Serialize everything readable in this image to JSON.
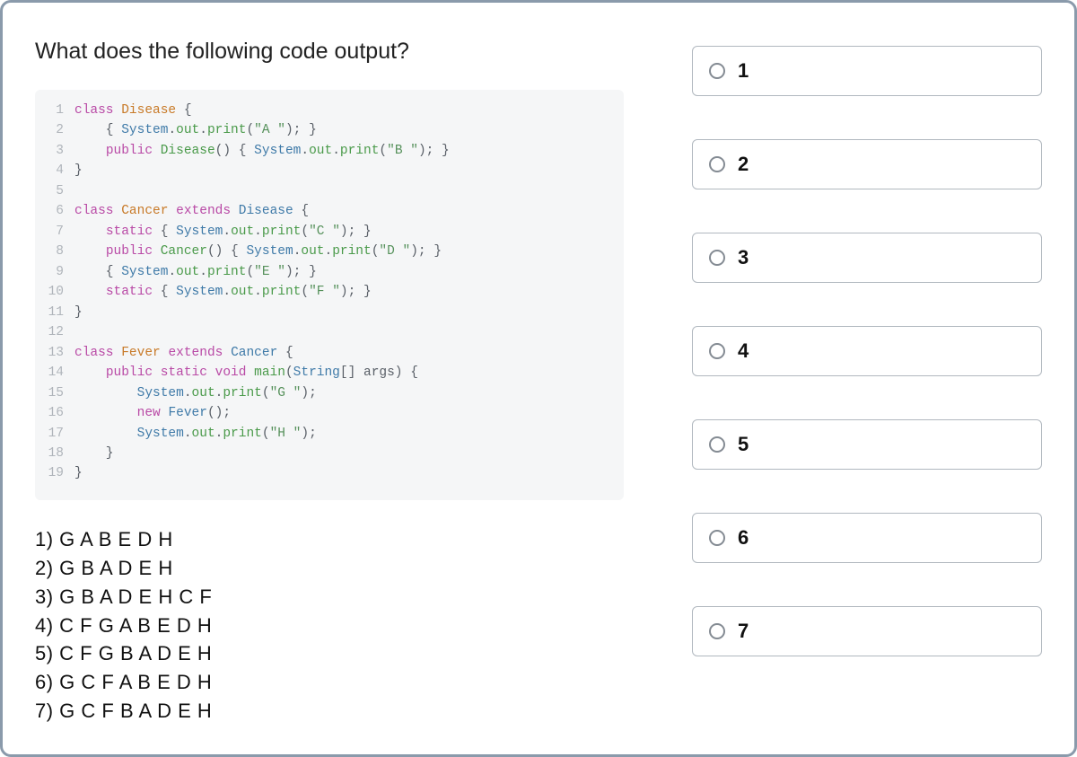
{
  "question": "What does the following code output?",
  "code": [
    {
      "n": "1",
      "tokens": [
        {
          "t": "class ",
          "c": "kw-struct"
        },
        {
          "t": "Disease",
          "c": "cls-def"
        },
        {
          "t": " {",
          "c": "punct"
        }
      ]
    },
    {
      "n": "2",
      "tokens": [
        {
          "t": "    { ",
          "c": "punct"
        },
        {
          "t": "System",
          "c": "obj"
        },
        {
          "t": ".",
          "c": "punct"
        },
        {
          "t": "out",
          "c": "method"
        },
        {
          "t": ".",
          "c": "punct"
        },
        {
          "t": "print",
          "c": "method"
        },
        {
          "t": "(",
          "c": "punct"
        },
        {
          "t": "\"A \"",
          "c": "str"
        },
        {
          "t": "); }",
          "c": "punct"
        }
      ]
    },
    {
      "n": "3",
      "tokens": [
        {
          "t": "    ",
          "c": ""
        },
        {
          "t": "public ",
          "c": "kw-struct"
        },
        {
          "t": "Disease",
          "c": "method"
        },
        {
          "t": "() { ",
          "c": "punct"
        },
        {
          "t": "System",
          "c": "obj"
        },
        {
          "t": ".",
          "c": "punct"
        },
        {
          "t": "out",
          "c": "method"
        },
        {
          "t": ".",
          "c": "punct"
        },
        {
          "t": "print",
          "c": "method"
        },
        {
          "t": "(",
          "c": "punct"
        },
        {
          "t": "\"B \"",
          "c": "str"
        },
        {
          "t": "); }",
          "c": "punct"
        }
      ]
    },
    {
      "n": "4",
      "tokens": [
        {
          "t": "}",
          "c": "punct"
        }
      ]
    },
    {
      "n": "5",
      "tokens": [
        {
          "t": "",
          "c": ""
        }
      ]
    },
    {
      "n": "6",
      "tokens": [
        {
          "t": "class ",
          "c": "kw-struct"
        },
        {
          "t": "Cancer",
          "c": "cls-def"
        },
        {
          "t": " ",
          "c": ""
        },
        {
          "t": "extends ",
          "c": "kw-struct"
        },
        {
          "t": "Disease",
          "c": "cls-ref"
        },
        {
          "t": " {",
          "c": "punct"
        }
      ]
    },
    {
      "n": "7",
      "tokens": [
        {
          "t": "    ",
          "c": ""
        },
        {
          "t": "static",
          "c": "kw-struct"
        },
        {
          "t": " { ",
          "c": "punct"
        },
        {
          "t": "System",
          "c": "obj"
        },
        {
          "t": ".",
          "c": "punct"
        },
        {
          "t": "out",
          "c": "method"
        },
        {
          "t": ".",
          "c": "punct"
        },
        {
          "t": "print",
          "c": "method"
        },
        {
          "t": "(",
          "c": "punct"
        },
        {
          "t": "\"C \"",
          "c": "str"
        },
        {
          "t": "); }",
          "c": "punct"
        }
      ]
    },
    {
      "n": "8",
      "tokens": [
        {
          "t": "    ",
          "c": ""
        },
        {
          "t": "public ",
          "c": "kw-struct"
        },
        {
          "t": "Cancer",
          "c": "method"
        },
        {
          "t": "() { ",
          "c": "punct"
        },
        {
          "t": "System",
          "c": "obj"
        },
        {
          "t": ".",
          "c": "punct"
        },
        {
          "t": "out",
          "c": "method"
        },
        {
          "t": ".",
          "c": "punct"
        },
        {
          "t": "print",
          "c": "method"
        },
        {
          "t": "(",
          "c": "punct"
        },
        {
          "t": "\"D \"",
          "c": "str"
        },
        {
          "t": "); }",
          "c": "punct"
        }
      ]
    },
    {
      "n": "9",
      "tokens": [
        {
          "t": "    { ",
          "c": "punct"
        },
        {
          "t": "System",
          "c": "obj"
        },
        {
          "t": ".",
          "c": "punct"
        },
        {
          "t": "out",
          "c": "method"
        },
        {
          "t": ".",
          "c": "punct"
        },
        {
          "t": "print",
          "c": "method"
        },
        {
          "t": "(",
          "c": "punct"
        },
        {
          "t": "\"E \"",
          "c": "str"
        },
        {
          "t": "); }",
          "c": "punct"
        }
      ]
    },
    {
      "n": "10",
      "tokens": [
        {
          "t": "    ",
          "c": ""
        },
        {
          "t": "static",
          "c": "kw-struct"
        },
        {
          "t": " { ",
          "c": "punct"
        },
        {
          "t": "System",
          "c": "obj"
        },
        {
          "t": ".",
          "c": "punct"
        },
        {
          "t": "out",
          "c": "method"
        },
        {
          "t": ".",
          "c": "punct"
        },
        {
          "t": "print",
          "c": "method"
        },
        {
          "t": "(",
          "c": "punct"
        },
        {
          "t": "\"F \"",
          "c": "str"
        },
        {
          "t": "); }",
          "c": "punct"
        }
      ]
    },
    {
      "n": "11",
      "tokens": [
        {
          "t": "}",
          "c": "punct"
        }
      ]
    },
    {
      "n": "12",
      "tokens": [
        {
          "t": "",
          "c": ""
        }
      ]
    },
    {
      "n": "13",
      "tokens": [
        {
          "t": "class ",
          "c": "kw-struct"
        },
        {
          "t": "Fever",
          "c": "cls-def"
        },
        {
          "t": " ",
          "c": ""
        },
        {
          "t": "extends ",
          "c": "kw-struct"
        },
        {
          "t": "Cancer",
          "c": "cls-ref"
        },
        {
          "t": " {",
          "c": "punct"
        }
      ]
    },
    {
      "n": "14",
      "tokens": [
        {
          "t": "    ",
          "c": ""
        },
        {
          "t": "public static ",
          "c": "kw-struct"
        },
        {
          "t": "void ",
          "c": "kw-type"
        },
        {
          "t": "main",
          "c": "method"
        },
        {
          "t": "(",
          "c": "punct"
        },
        {
          "t": "String",
          "c": "cls-ref"
        },
        {
          "t": "[] args) {",
          "c": "punct"
        }
      ]
    },
    {
      "n": "15",
      "tokens": [
        {
          "t": "        ",
          "c": ""
        },
        {
          "t": "System",
          "c": "obj"
        },
        {
          "t": ".",
          "c": "punct"
        },
        {
          "t": "out",
          "c": "method"
        },
        {
          "t": ".",
          "c": "punct"
        },
        {
          "t": "print",
          "c": "method"
        },
        {
          "t": "(",
          "c": "punct"
        },
        {
          "t": "\"G \"",
          "c": "str"
        },
        {
          "t": ");",
          "c": "punct"
        }
      ]
    },
    {
      "n": "16",
      "tokens": [
        {
          "t": "        ",
          "c": ""
        },
        {
          "t": "new ",
          "c": "new"
        },
        {
          "t": "Fever",
          "c": "cls-ref"
        },
        {
          "t": "();",
          "c": "punct"
        }
      ]
    },
    {
      "n": "17",
      "tokens": [
        {
          "t": "        ",
          "c": ""
        },
        {
          "t": "System",
          "c": "obj"
        },
        {
          "t": ".",
          "c": "punct"
        },
        {
          "t": "out",
          "c": "method"
        },
        {
          "t": ".",
          "c": "punct"
        },
        {
          "t": "print",
          "c": "method"
        },
        {
          "t": "(",
          "c": "punct"
        },
        {
          "t": "\"H \"",
          "c": "str"
        },
        {
          "t": ");",
          "c": "punct"
        }
      ]
    },
    {
      "n": "18",
      "tokens": [
        {
          "t": "    }",
          "c": "punct"
        }
      ]
    },
    {
      "n": "19",
      "tokens": [
        {
          "t": "}",
          "c": "punct"
        }
      ]
    }
  ],
  "answers": [
    "1) G A B E D H",
    "2) G B A D E H",
    "3) G B A D E H C F",
    "4) C F G A B E D H",
    "5) C F G B A D E H",
    "6) G C F A B E D H",
    "7) G C F B A D E H"
  ],
  "options": [
    "1",
    "2",
    "3",
    "4",
    "5",
    "6",
    "7"
  ]
}
